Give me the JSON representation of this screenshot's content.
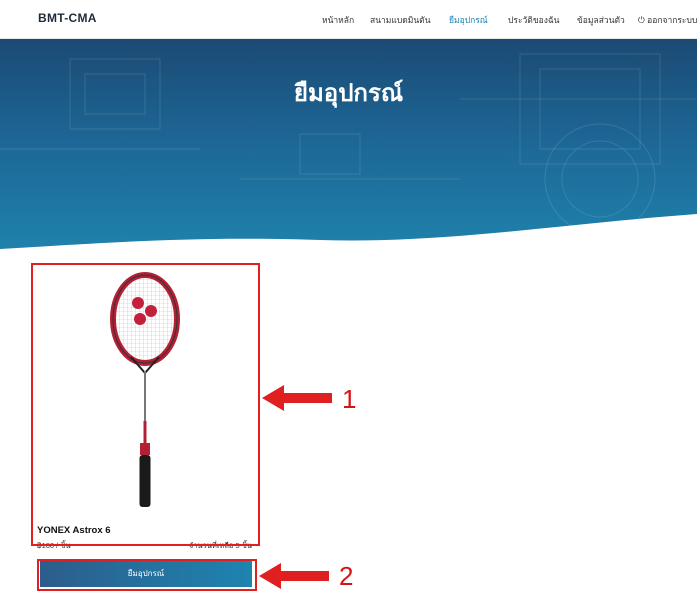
{
  "nav": {
    "brand": "BMT-CMA",
    "items": [
      {
        "label": "หน้าหลัก"
      },
      {
        "label": "สนามแบดมินตัน"
      },
      {
        "label": "ยืมอุปกรณ์"
      },
      {
        "label": "ประวัติของฉัน"
      },
      {
        "label": "ข้อมูลส่วนตัว"
      },
      {
        "label": "ออกจากระบบ"
      }
    ],
    "logout_icon": "power-icon",
    "active_index": 2
  },
  "hero": {
    "title": "ยืมอุปกรณ์"
  },
  "product": {
    "name": "YONEX Astrox 6",
    "price": "฿160 / ชิ้น",
    "stock": "จำนวนที่เหลือ 5 ชิ้น",
    "image": "badminton-racket"
  },
  "actions": {
    "borrow_label": "ยืมอุปกรณ์"
  },
  "annotations": {
    "callout_1": "1",
    "callout_2": "2",
    "color": "#e02020"
  },
  "colors": {
    "accent": "#1e7fb5",
    "hero_dark": "#1b4a74",
    "hero_light": "#1f83ad"
  }
}
